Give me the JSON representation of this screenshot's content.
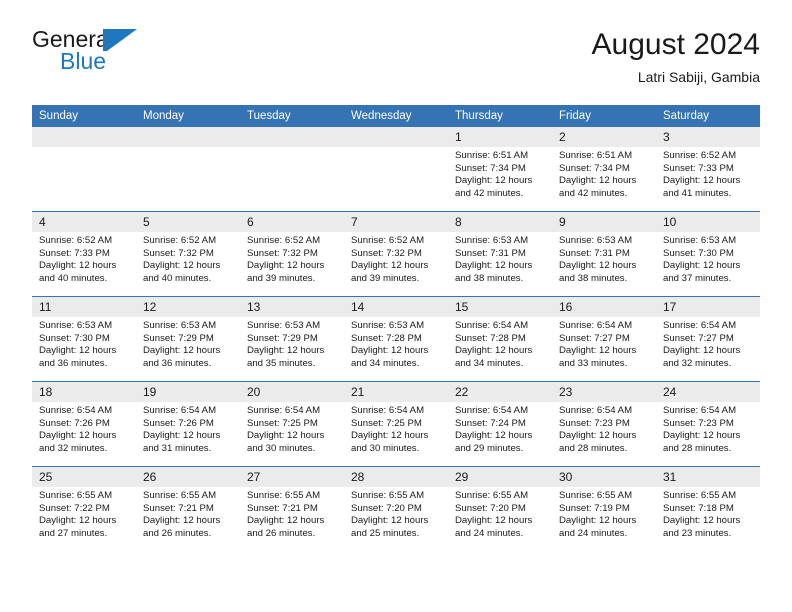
{
  "brand": {
    "name_part1": "General",
    "name_part2": "Blue",
    "flag_icon": "blue-flag-triangle",
    "accent_color": "#1f77bd"
  },
  "header": {
    "title": "August 2024",
    "subtitle": "Latri Sabiji, Gambia"
  },
  "theme": {
    "header_blue": "#3573b4",
    "daynum_grey": "#ebebeb",
    "text": "#1a1a1a"
  },
  "calendar": {
    "weekday_headers": [
      "Sunday",
      "Monday",
      "Tuesday",
      "Wednesday",
      "Thursday",
      "Friday",
      "Saturday"
    ],
    "weeks": [
      [
        {
          "day": "",
          "empty": true
        },
        {
          "day": "",
          "empty": true
        },
        {
          "day": "",
          "empty": true
        },
        {
          "day": "",
          "empty": true
        },
        {
          "day": "1",
          "sunrise": "Sunrise: 6:51 AM",
          "sunset": "Sunset: 7:34 PM",
          "daylight": "Daylight: 12 hours and 42 minutes."
        },
        {
          "day": "2",
          "sunrise": "Sunrise: 6:51 AM",
          "sunset": "Sunset: 7:34 PM",
          "daylight": "Daylight: 12 hours and 42 minutes."
        },
        {
          "day": "3",
          "sunrise": "Sunrise: 6:52 AM",
          "sunset": "Sunset: 7:33 PM",
          "daylight": "Daylight: 12 hours and 41 minutes."
        }
      ],
      [
        {
          "day": "4",
          "sunrise": "Sunrise: 6:52 AM",
          "sunset": "Sunset: 7:33 PM",
          "daylight": "Daylight: 12 hours and 40 minutes."
        },
        {
          "day": "5",
          "sunrise": "Sunrise: 6:52 AM",
          "sunset": "Sunset: 7:32 PM",
          "daylight": "Daylight: 12 hours and 40 minutes."
        },
        {
          "day": "6",
          "sunrise": "Sunrise: 6:52 AM",
          "sunset": "Sunset: 7:32 PM",
          "daylight": "Daylight: 12 hours and 39 minutes."
        },
        {
          "day": "7",
          "sunrise": "Sunrise: 6:52 AM",
          "sunset": "Sunset: 7:32 PM",
          "daylight": "Daylight: 12 hours and 39 minutes."
        },
        {
          "day": "8",
          "sunrise": "Sunrise: 6:53 AM",
          "sunset": "Sunset: 7:31 PM",
          "daylight": "Daylight: 12 hours and 38 minutes."
        },
        {
          "day": "9",
          "sunrise": "Sunrise: 6:53 AM",
          "sunset": "Sunset: 7:31 PM",
          "daylight": "Daylight: 12 hours and 38 minutes."
        },
        {
          "day": "10",
          "sunrise": "Sunrise: 6:53 AM",
          "sunset": "Sunset: 7:30 PM",
          "daylight": "Daylight: 12 hours and 37 minutes."
        }
      ],
      [
        {
          "day": "11",
          "sunrise": "Sunrise: 6:53 AM",
          "sunset": "Sunset: 7:30 PM",
          "daylight": "Daylight: 12 hours and 36 minutes."
        },
        {
          "day": "12",
          "sunrise": "Sunrise: 6:53 AM",
          "sunset": "Sunset: 7:29 PM",
          "daylight": "Daylight: 12 hours and 36 minutes."
        },
        {
          "day": "13",
          "sunrise": "Sunrise: 6:53 AM",
          "sunset": "Sunset: 7:29 PM",
          "daylight": "Daylight: 12 hours and 35 minutes."
        },
        {
          "day": "14",
          "sunrise": "Sunrise: 6:53 AM",
          "sunset": "Sunset: 7:28 PM",
          "daylight": "Daylight: 12 hours and 34 minutes."
        },
        {
          "day": "15",
          "sunrise": "Sunrise: 6:54 AM",
          "sunset": "Sunset: 7:28 PM",
          "daylight": "Daylight: 12 hours and 34 minutes."
        },
        {
          "day": "16",
          "sunrise": "Sunrise: 6:54 AM",
          "sunset": "Sunset: 7:27 PM",
          "daylight": "Daylight: 12 hours and 33 minutes."
        },
        {
          "day": "17",
          "sunrise": "Sunrise: 6:54 AM",
          "sunset": "Sunset: 7:27 PM",
          "daylight": "Daylight: 12 hours and 32 minutes."
        }
      ],
      [
        {
          "day": "18",
          "sunrise": "Sunrise: 6:54 AM",
          "sunset": "Sunset: 7:26 PM",
          "daylight": "Daylight: 12 hours and 32 minutes."
        },
        {
          "day": "19",
          "sunrise": "Sunrise: 6:54 AM",
          "sunset": "Sunset: 7:26 PM",
          "daylight": "Daylight: 12 hours and 31 minutes."
        },
        {
          "day": "20",
          "sunrise": "Sunrise: 6:54 AM",
          "sunset": "Sunset: 7:25 PM",
          "daylight": "Daylight: 12 hours and 30 minutes."
        },
        {
          "day": "21",
          "sunrise": "Sunrise: 6:54 AM",
          "sunset": "Sunset: 7:25 PM",
          "daylight": "Daylight: 12 hours and 30 minutes."
        },
        {
          "day": "22",
          "sunrise": "Sunrise: 6:54 AM",
          "sunset": "Sunset: 7:24 PM",
          "daylight": "Daylight: 12 hours and 29 minutes."
        },
        {
          "day": "23",
          "sunrise": "Sunrise: 6:54 AM",
          "sunset": "Sunset: 7:23 PM",
          "daylight": "Daylight: 12 hours and 28 minutes."
        },
        {
          "day": "24",
          "sunrise": "Sunrise: 6:54 AM",
          "sunset": "Sunset: 7:23 PM",
          "daylight": "Daylight: 12 hours and 28 minutes."
        }
      ],
      [
        {
          "day": "25",
          "sunrise": "Sunrise: 6:55 AM",
          "sunset": "Sunset: 7:22 PM",
          "daylight": "Daylight: 12 hours and 27 minutes."
        },
        {
          "day": "26",
          "sunrise": "Sunrise: 6:55 AM",
          "sunset": "Sunset: 7:21 PM",
          "daylight": "Daylight: 12 hours and 26 minutes."
        },
        {
          "day": "27",
          "sunrise": "Sunrise: 6:55 AM",
          "sunset": "Sunset: 7:21 PM",
          "daylight": "Daylight: 12 hours and 26 minutes."
        },
        {
          "day": "28",
          "sunrise": "Sunrise: 6:55 AM",
          "sunset": "Sunset: 7:20 PM",
          "daylight": "Daylight: 12 hours and 25 minutes."
        },
        {
          "day": "29",
          "sunrise": "Sunrise: 6:55 AM",
          "sunset": "Sunset: 7:20 PM",
          "daylight": "Daylight: 12 hours and 24 minutes."
        },
        {
          "day": "30",
          "sunrise": "Sunrise: 6:55 AM",
          "sunset": "Sunset: 7:19 PM",
          "daylight": "Daylight: 12 hours and 24 minutes."
        },
        {
          "day": "31",
          "sunrise": "Sunrise: 6:55 AM",
          "sunset": "Sunset: 7:18 PM",
          "daylight": "Daylight: 12 hours and 23 minutes."
        }
      ]
    ]
  }
}
